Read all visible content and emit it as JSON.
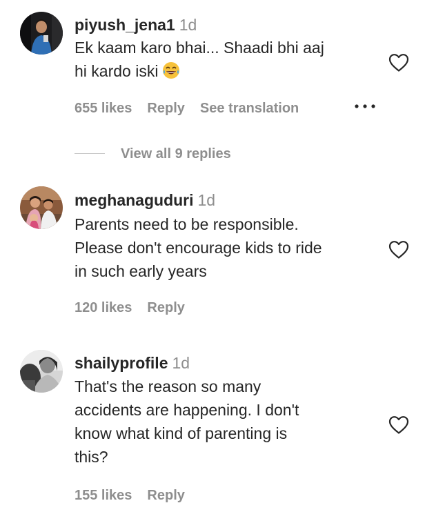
{
  "comments": [
    {
      "username": "piyush_jena1",
      "time": "1d",
      "lines": [
        "Ek kaam karo bhai... Shaadi bhi aaj",
        "hi kardo iski"
      ],
      "emoji": "face-with-tears-of-joy",
      "likes": "655 likes",
      "reply": "Reply",
      "translation": "See translation",
      "more": "•••",
      "replies_label": "View all 9 replies"
    },
    {
      "username": "meghanaguduri",
      "time": "1d",
      "lines": [
        "Parents need to be responsible.",
        "Please don't encourage kids to ride",
        "in such early years"
      ],
      "likes": "120 likes",
      "reply": "Reply"
    },
    {
      "username": "shailyprofile",
      "time": "1d",
      "lines": [
        "That's the reason so many",
        "accidents are happening. I don't",
        "know what kind of parenting is",
        "this?"
      ],
      "likes": "155 likes",
      "reply": "Reply"
    }
  ],
  "colors": {
    "text": "#262626",
    "secondary": "#8e8e8e"
  },
  "icons": {
    "like": "heart-outline-icon",
    "more": "more-options-icon"
  }
}
